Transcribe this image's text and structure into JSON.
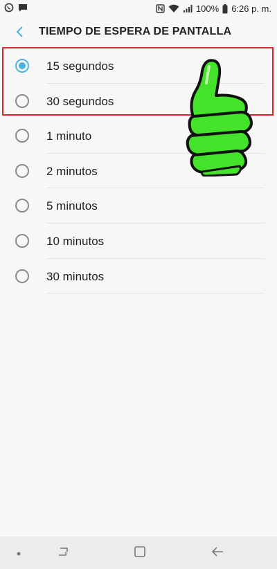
{
  "status_bar": {
    "battery_percent": "100%",
    "time": "6:26 p. m.",
    "icons": [
      "whatsapp-icon",
      "message-icon",
      "nfc-icon",
      "wifi-icon",
      "signal-icon",
      "battery-icon"
    ]
  },
  "header": {
    "title": "TIEMPO DE ESPERA DE PANTALLA",
    "back_icon": "back-arrow-icon"
  },
  "options": [
    {
      "label": "15 segundos",
      "selected": true
    },
    {
      "label": "30 segundos",
      "selected": false
    },
    {
      "label": "1 minuto",
      "selected": false
    },
    {
      "label": "2 minutos",
      "selected": false
    },
    {
      "label": "5 minutos",
      "selected": false
    },
    {
      "label": "10 minutos",
      "selected": false
    },
    {
      "label": "30 minutos",
      "selected": false
    }
  ],
  "overlay": {
    "highlight_color": "#d7262e",
    "illustration": "thumbs-up-icon",
    "illustration_color": "#44e22a"
  },
  "nav_bar": {
    "buttons": [
      "dot-icon",
      "recent-apps-icon",
      "home-icon",
      "back-icon"
    ]
  },
  "colors": {
    "accent": "#4fb3e0",
    "background": "#f7f7f7",
    "nav_background": "#ececec"
  }
}
